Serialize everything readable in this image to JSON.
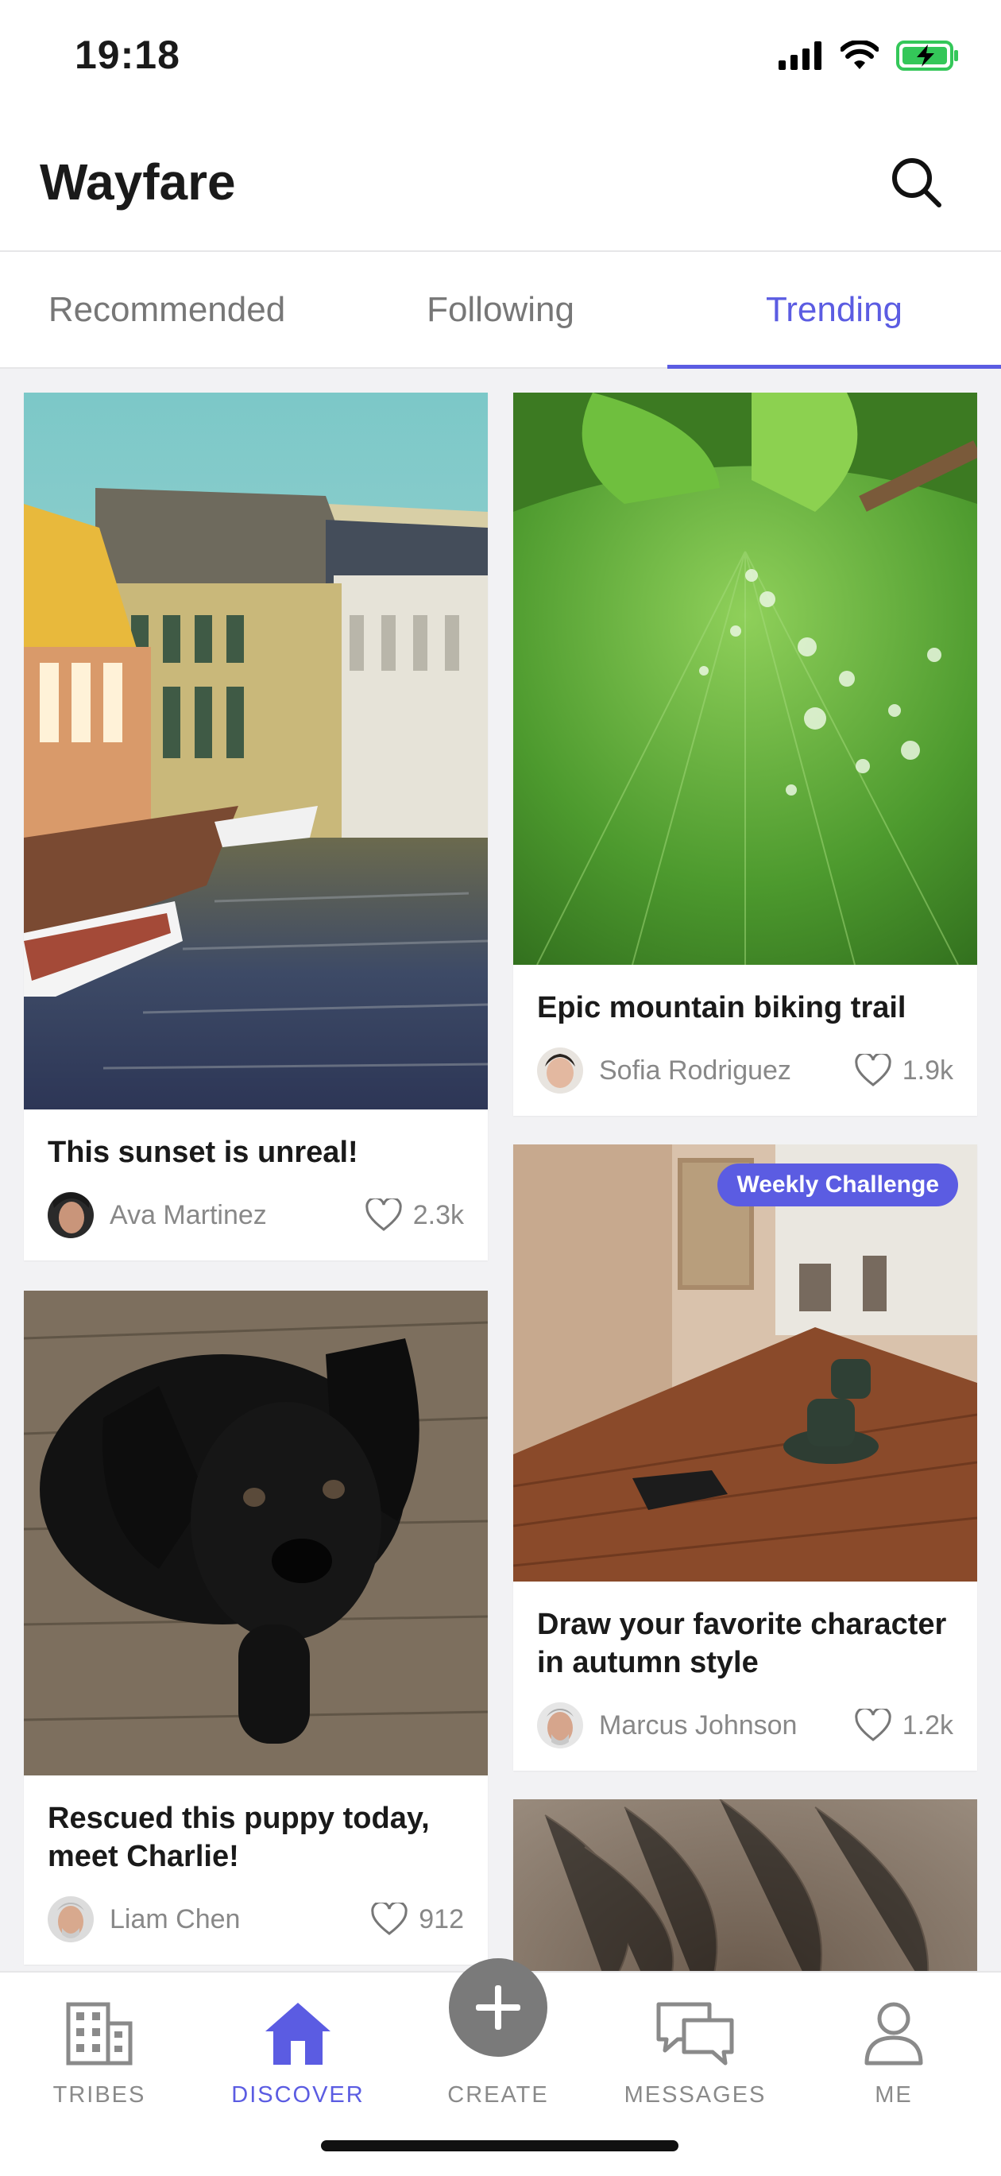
{
  "status_bar": {
    "time": "19:18"
  },
  "header": {
    "title": "Wayfare"
  },
  "tabs": [
    {
      "label": "Recommended",
      "active": false
    },
    {
      "label": "Following",
      "active": false
    },
    {
      "label": "Trending",
      "active": true
    }
  ],
  "feed": {
    "cards": [
      {
        "title": "This sunset is unreal!",
        "author": "Ava Martinez",
        "likes": "2.3k"
      },
      {
        "title": "Epic mountain biking trail",
        "author": "Sofia Rodriguez",
        "likes": "1.9k"
      },
      {
        "title": "Rescued this puppy today, meet Charlie!",
        "author": "Liam Chen",
        "likes": "912"
      },
      {
        "title": "Draw your favorite character in autumn style",
        "author": "Marcus Johnson",
        "likes": "1.2k",
        "badge": "Weekly Challenge"
      }
    ]
  },
  "bottom_nav": {
    "items": [
      {
        "label": "TRIBES",
        "icon": "building-icon",
        "active": false
      },
      {
        "label": "DISCOVER",
        "icon": "home-icon",
        "active": true
      },
      {
        "label": "CREATE",
        "icon": "plus-icon",
        "active": false
      },
      {
        "label": "MESSAGES",
        "icon": "chat-bubbles-icon",
        "active": false
      },
      {
        "label": "ME",
        "icon": "person-icon",
        "active": false
      }
    ]
  },
  "colors": {
    "accent": "#5b5ce2",
    "text_muted": "#888888",
    "background": "#f2f2f4"
  }
}
